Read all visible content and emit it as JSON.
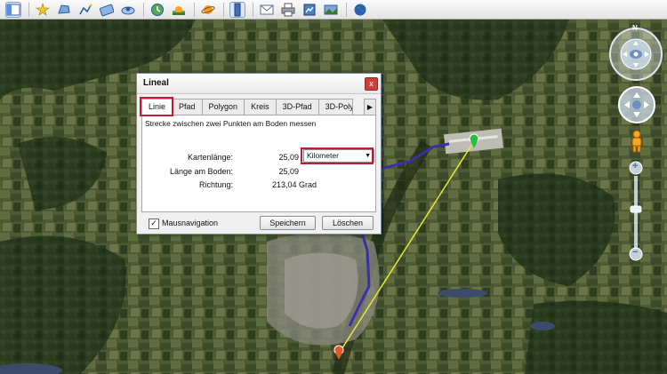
{
  "toolbar": {
    "buttons": [
      {
        "icon": "sidebar-icon"
      },
      {
        "icon": "placemark-icon"
      },
      {
        "icon": "polygon-icon"
      },
      {
        "icon": "path-icon"
      },
      {
        "icon": "image-overlay-icon"
      },
      {
        "icon": "tour-icon"
      },
      {
        "icon": "historical-imagery-icon"
      },
      {
        "icon": "sunlight-icon"
      },
      {
        "icon": "planets-icon"
      },
      {
        "icon": "ruler-icon"
      },
      {
        "icon": "email-icon"
      },
      {
        "icon": "print-icon"
      },
      {
        "icon": "kml-icon"
      },
      {
        "icon": "photo-icon"
      },
      {
        "icon": "earth-icon"
      }
    ]
  },
  "dialog": {
    "title": "Lineal",
    "close": "x",
    "tabs": [
      "Linie",
      "Pfad",
      "Polygon",
      "Kreis",
      "3D-Pfad",
      "3D-Poly"
    ],
    "tab_scroll": "▶",
    "description": "Strecke zwischen zwei Punkten am Boden messen",
    "map_length_label": "Kartenlänge:",
    "map_length_value": "25,09",
    "unit_select": "Kilometer",
    "ground_length_label": "Länge am Boden:",
    "ground_length_value": "25,09",
    "direction_label": "Richtung:",
    "direction_value": "213,04 Grad",
    "mouse_nav_label": "Mausnavigation",
    "mouse_nav_checked": true,
    "check_mark": "✓",
    "save_button": "Speichern",
    "delete_button": "Löschen"
  },
  "nav": {
    "compass_north": "N",
    "zoom_plus": "+",
    "zoom_minus": "−"
  },
  "colors": {
    "highlight": "#c11b3c",
    "measure_line": "#e8e83a",
    "route_line": "#3a2fa8",
    "start_marker": "#2fb84a",
    "end_marker": "#e05a2b"
  }
}
